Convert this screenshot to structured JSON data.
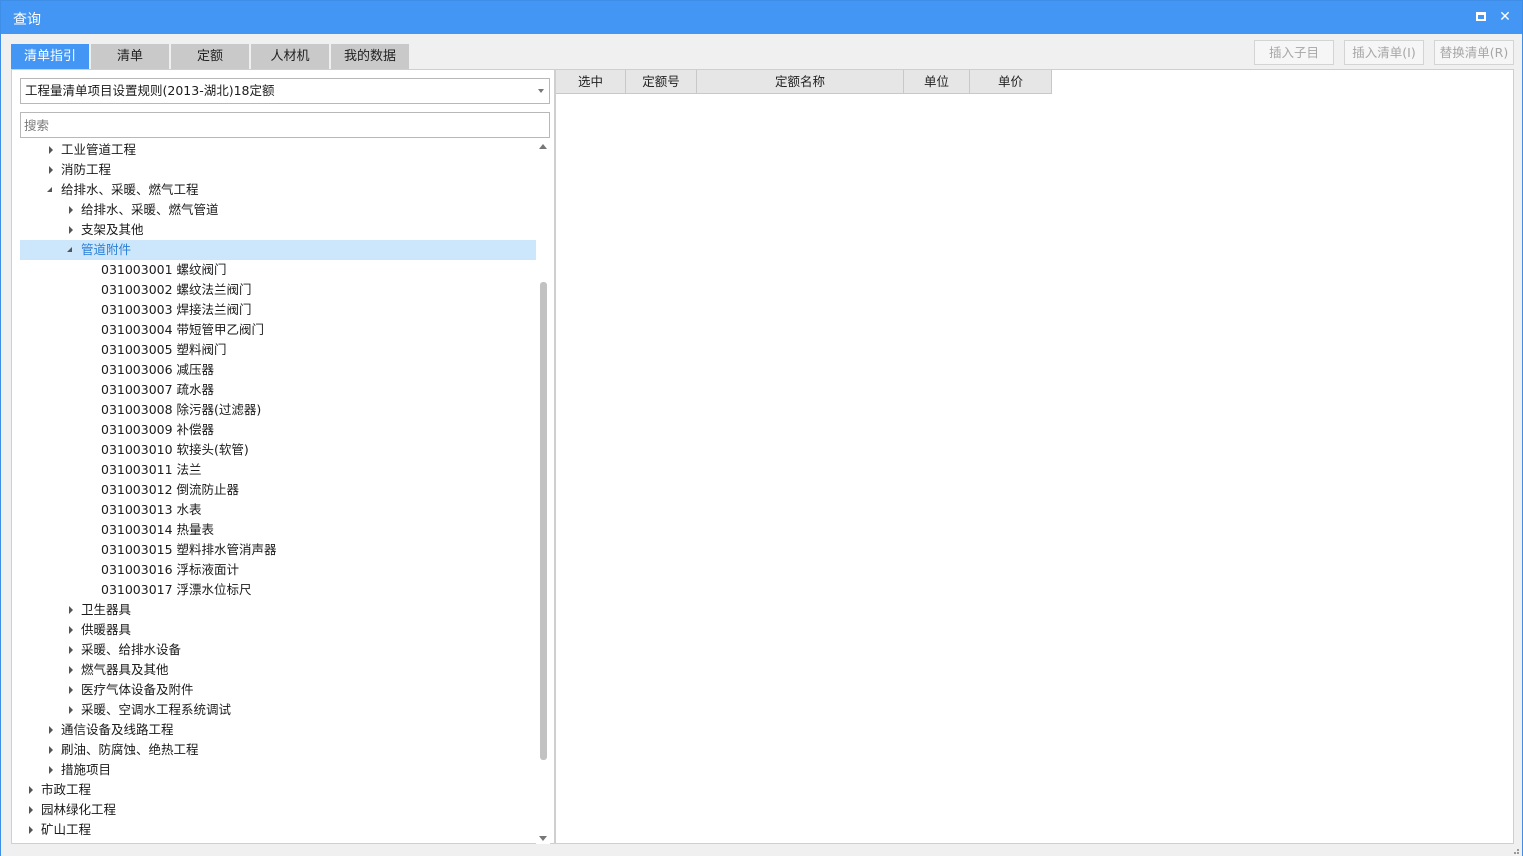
{
  "window": {
    "title": "查询",
    "maximize_icon": "maximize-icon",
    "close_icon": "close-icon"
  },
  "tabs": [
    {
      "label": "清单指引",
      "active": true
    },
    {
      "label": "清单",
      "active": false
    },
    {
      "label": "定额",
      "active": false
    },
    {
      "label": "人材机",
      "active": false
    },
    {
      "label": "我的数据",
      "active": false
    }
  ],
  "actions": {
    "insert_child": "插入子目",
    "insert_list": "插入清单(I)",
    "replace_list": "替换清单(R)"
  },
  "rule_select": {
    "value": "工程量清单项目设置规则(2013-湖北)18定额"
  },
  "search": {
    "placeholder": "搜索"
  },
  "tree": [
    {
      "label": "工业管道工程",
      "level": 1,
      "state": "collapsed"
    },
    {
      "label": "消防工程",
      "level": 1,
      "state": "collapsed"
    },
    {
      "label": "给排水、采暖、燃气工程",
      "level": 1,
      "state": "expanded"
    },
    {
      "label": "给排水、采暖、燃气管道",
      "level": 2,
      "state": "collapsed"
    },
    {
      "label": "支架及其他",
      "level": 2,
      "state": "collapsed"
    },
    {
      "label": "管道附件",
      "level": 2,
      "state": "expanded",
      "selected": true
    },
    {
      "label": "031003001  螺纹阀门",
      "level": 3,
      "state": "leaf"
    },
    {
      "label": "031003002  螺纹法兰阀门",
      "level": 3,
      "state": "leaf"
    },
    {
      "label": "031003003  焊接法兰阀门",
      "level": 3,
      "state": "leaf"
    },
    {
      "label": "031003004  带短管甲乙阀门",
      "level": 3,
      "state": "leaf"
    },
    {
      "label": "031003005  塑料阀门",
      "level": 3,
      "state": "leaf"
    },
    {
      "label": "031003006  减压器",
      "level": 3,
      "state": "leaf"
    },
    {
      "label": "031003007  疏水器",
      "level": 3,
      "state": "leaf"
    },
    {
      "label": "031003008  除污器(过滤器)",
      "level": 3,
      "state": "leaf"
    },
    {
      "label": "031003009  补偿器",
      "level": 3,
      "state": "leaf"
    },
    {
      "label": "031003010  软接头(软管)",
      "level": 3,
      "state": "leaf"
    },
    {
      "label": "031003011  法兰",
      "level": 3,
      "state": "leaf"
    },
    {
      "label": "031003012  倒流防止器",
      "level": 3,
      "state": "leaf"
    },
    {
      "label": "031003013  水表",
      "level": 3,
      "state": "leaf"
    },
    {
      "label": "031003014  热量表",
      "level": 3,
      "state": "leaf"
    },
    {
      "label": "031003015  塑料排水管消声器",
      "level": 3,
      "state": "leaf"
    },
    {
      "label": "031003016  浮标液面计",
      "level": 3,
      "state": "leaf"
    },
    {
      "label": "031003017  浮漂水位标尺",
      "level": 3,
      "state": "leaf"
    },
    {
      "label": "卫生器具",
      "level": 2,
      "state": "collapsed"
    },
    {
      "label": "供暖器具",
      "level": 2,
      "state": "collapsed"
    },
    {
      "label": "采暖、给排水设备",
      "level": 2,
      "state": "collapsed"
    },
    {
      "label": "燃气器具及其他",
      "level": 2,
      "state": "collapsed"
    },
    {
      "label": "医疗气体设备及附件",
      "level": 2,
      "state": "collapsed"
    },
    {
      "label": "采暖、空调水工程系统调试",
      "level": 2,
      "state": "collapsed"
    },
    {
      "label": "通信设备及线路工程",
      "level": 1,
      "state": "collapsed"
    },
    {
      "label": "刷油、防腐蚀、绝热工程",
      "level": 1,
      "state": "collapsed"
    },
    {
      "label": "措施项目",
      "level": 1,
      "state": "collapsed"
    },
    {
      "label": "市政工程",
      "level": 0,
      "state": "collapsed"
    },
    {
      "label": "园林绿化工程",
      "level": 0,
      "state": "collapsed"
    },
    {
      "label": "矿山工程",
      "level": 0,
      "state": "collapsed"
    }
  ],
  "grid": {
    "columns": [
      "选中",
      "定额号",
      "定额名称",
      "单位",
      "单价"
    ]
  },
  "colors": {
    "accent": "#4396f3",
    "selected_bg": "#cce6fb",
    "selected_text": "#2a7ed8",
    "tab_inactive": "#c9c9c9"
  }
}
